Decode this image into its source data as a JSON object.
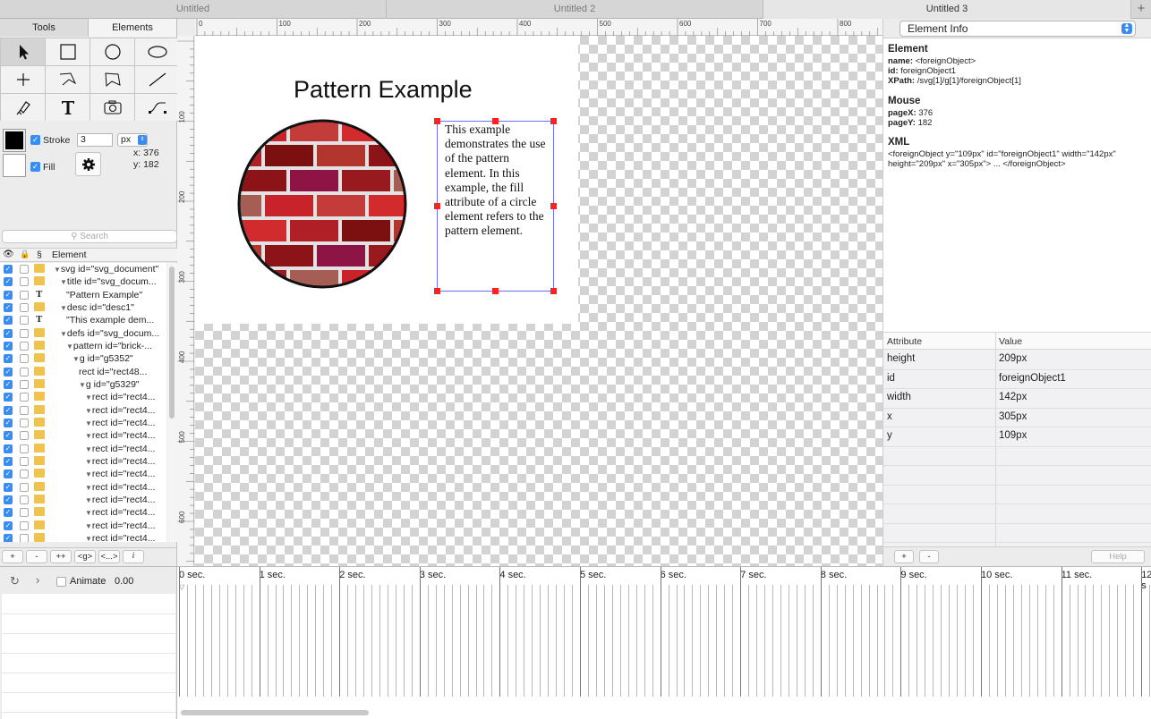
{
  "tabs": [
    {
      "label": "Untitled",
      "active": false
    },
    {
      "label": "Untitled 2",
      "active": false
    },
    {
      "label": "Untitled 3",
      "active": true
    }
  ],
  "tab_add_label": "+",
  "panel_tabs": {
    "tools": "Tools",
    "elements": "Elements"
  },
  "tools": [
    {
      "name": "select-arrow-icon"
    },
    {
      "name": "rectangle-icon"
    },
    {
      "name": "circle-icon"
    },
    {
      "name": "ellipse-icon"
    },
    {
      "name": "crosshair-icon"
    },
    {
      "name": "polyline-icon"
    },
    {
      "name": "polygon-icon"
    },
    {
      "name": "line-icon"
    },
    {
      "name": "pen-icon"
    },
    {
      "name": "text-icon"
    },
    {
      "name": "camera-icon"
    },
    {
      "name": "path-icon"
    }
  ],
  "style": {
    "stroke_label": "Stroke",
    "stroke_width": "3",
    "stroke_unit": "px",
    "fill_label": "Fill",
    "stroke_color": "#000000",
    "fill_color": "#ffffff",
    "coord_x": "x: 376",
    "coord_y": "y: 182"
  },
  "search_placeholder": "Search",
  "tree_header": {
    "section": "§",
    "element": "Element"
  },
  "tree": [
    {
      "indent": 0,
      "arrow": "▼",
      "kind": "folder",
      "label": "svg id=\"svg_document\""
    },
    {
      "indent": 1,
      "arrow": "▼",
      "kind": "folder",
      "label": "title id=\"svg_docum..."
    },
    {
      "indent": 2,
      "arrow": "",
      "kind": "text",
      "label": "\"Pattern Example\""
    },
    {
      "indent": 1,
      "arrow": "▼",
      "kind": "folder",
      "label": "desc id=\"desc1\""
    },
    {
      "indent": 2,
      "arrow": "",
      "kind": "text",
      "label": "\"This example dem..."
    },
    {
      "indent": 1,
      "arrow": "▼",
      "kind": "folder",
      "label": "defs id=\"svg_docum..."
    },
    {
      "indent": 2,
      "arrow": "▼",
      "kind": "folder",
      "label": "pattern id=\"brick-..."
    },
    {
      "indent": 3,
      "arrow": "▼",
      "kind": "folder",
      "label": "g id=\"g5352\""
    },
    {
      "indent": 4,
      "arrow": "",
      "kind": "folder",
      "label": "rect id=\"rect48..."
    },
    {
      "indent": 4,
      "arrow": "▼",
      "kind": "folder",
      "label": "g id=\"g5329\""
    },
    {
      "indent": 5,
      "arrow": "▼",
      "kind": "folder",
      "label": "rect id=\"rect4..."
    },
    {
      "indent": 5,
      "arrow": "▼",
      "kind": "folder",
      "label": "rect id=\"rect4..."
    },
    {
      "indent": 5,
      "arrow": "▼",
      "kind": "folder",
      "label": "rect id=\"rect4..."
    },
    {
      "indent": 5,
      "arrow": "▼",
      "kind": "folder",
      "label": "rect id=\"rect4..."
    },
    {
      "indent": 5,
      "arrow": "▼",
      "kind": "folder",
      "label": "rect id=\"rect4..."
    },
    {
      "indent": 5,
      "arrow": "▼",
      "kind": "folder",
      "label": "rect id=\"rect4..."
    },
    {
      "indent": 5,
      "arrow": "▼",
      "kind": "folder",
      "label": "rect id=\"rect4..."
    },
    {
      "indent": 5,
      "arrow": "▼",
      "kind": "folder",
      "label": "rect id=\"rect4..."
    },
    {
      "indent": 5,
      "arrow": "▼",
      "kind": "folder",
      "label": "rect id=\"rect4..."
    },
    {
      "indent": 5,
      "arrow": "▼",
      "kind": "folder",
      "label": "rect id=\"rect4..."
    },
    {
      "indent": 5,
      "arrow": "▼",
      "kind": "folder",
      "label": "rect id=\"rect4..."
    },
    {
      "indent": 5,
      "arrow": "▼",
      "kind": "folder",
      "label": "rect id=\"rect4..."
    }
  ],
  "tree_footer": [
    "+",
    "-",
    "++",
    "<g>",
    "<...>",
    "i"
  ],
  "ruler_h": [
    "0",
    "100",
    "200",
    "300",
    "400",
    "500",
    "600",
    "700",
    "800"
  ],
  "ruler_v": [
    "100",
    "200",
    "300",
    "400",
    "500",
    "600"
  ],
  "document": {
    "title": "Pattern Example",
    "text": "This example demonstrates the use of the pattern element. In this example, the fill attribute of a circle element refers to the pattern element."
  },
  "info": {
    "dropdown": "Element Info",
    "element_heading": "Element",
    "name_label": "name:",
    "name_value": "<foreignObject>",
    "id_label": "id:",
    "id_value": "foreignObject1",
    "xpath_label": "XPath:",
    "xpath_value": "/svg[1]/g[1]/foreignObject[1]",
    "mouse_heading": "Mouse",
    "pagex_label": "pageX:",
    "pagex_value": "376",
    "pagey_label": "pageY:",
    "pagey_value": "182",
    "xml_heading": "XML",
    "xml_line1": "<foreignObject y=\"109px\" id=\"foreignObject1\" width=\"142px\"",
    "xml_line2": "height=\"209px\" x=\"305px\"> ... </foreignObject>"
  },
  "attributes": {
    "header_attr": "Attribute",
    "header_value": "Value",
    "rows": [
      {
        "attr": "height",
        "value": "209px"
      },
      {
        "attr": "id",
        "value": "foreignObject1"
      },
      {
        "attr": "width",
        "value": "142px"
      },
      {
        "attr": "x",
        "value": "305px"
      },
      {
        "attr": "y",
        "value": "109px"
      }
    ]
  },
  "attr_footer": {
    "add": "+",
    "remove": "-",
    "help": "Help"
  },
  "timeline": {
    "animate_label": "Animate",
    "time_value": "0.00",
    "seconds": [
      "0 sec.",
      "1 sec.",
      "2 sec.",
      "3 sec.",
      "4 sec.",
      "5 sec.",
      "6 sec.",
      "7 sec.",
      "8 sec.",
      "9 sec.",
      "10 sec.",
      "11 sec.",
      "12 s"
    ]
  },
  "colors": {
    "accent": "#3b8cf0",
    "selection": "#6e6ef0",
    "handle": "#ff2020"
  }
}
